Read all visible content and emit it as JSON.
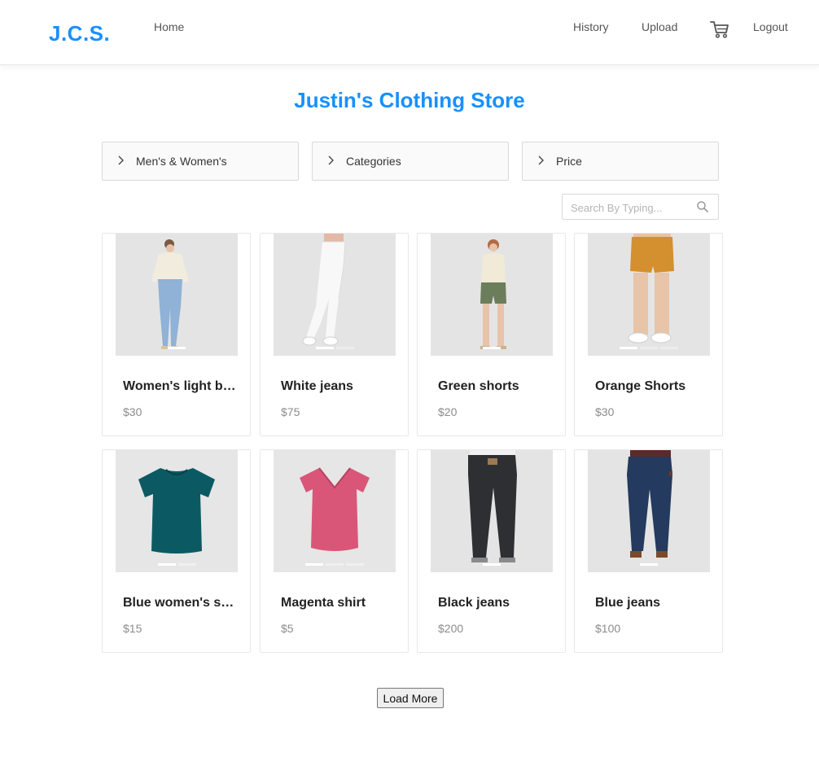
{
  "nav": {
    "logo": "J.C.S.",
    "home": "Home",
    "history": "History",
    "upload": "Upload",
    "cart_icon": "cart-icon",
    "logout": "Logout"
  },
  "page": {
    "title": "Justin's Clothing Store"
  },
  "filters": [
    {
      "label": "Men's & Women's",
      "icon": "chevron-right-icon"
    },
    {
      "label": "Categories",
      "icon": "chevron-right-icon"
    },
    {
      "label": "Price",
      "icon": "chevron-right-icon"
    }
  ],
  "search": {
    "placeholder": "Search By Typing...",
    "value": "",
    "icon": "search-icon"
  },
  "products": [
    {
      "name": "Women's light blue jeans",
      "price": "$30"
    },
    {
      "name": "White jeans",
      "price": "$75"
    },
    {
      "name": "Green shorts",
      "price": "$20"
    },
    {
      "name": "Orange Shorts",
      "price": "$30"
    },
    {
      "name": "Blue women's shirt",
      "price": "$15"
    },
    {
      "name": "Magenta shirt",
      "price": "$5"
    },
    {
      "name": "Black jeans",
      "price": "$200"
    },
    {
      "name": "Blue jeans",
      "price": "$100"
    }
  ],
  "load_more": "Load More",
  "colors": {
    "brand": "#1890ff",
    "border": "#e8e8e8",
    "price": "#8c8c8c"
  }
}
